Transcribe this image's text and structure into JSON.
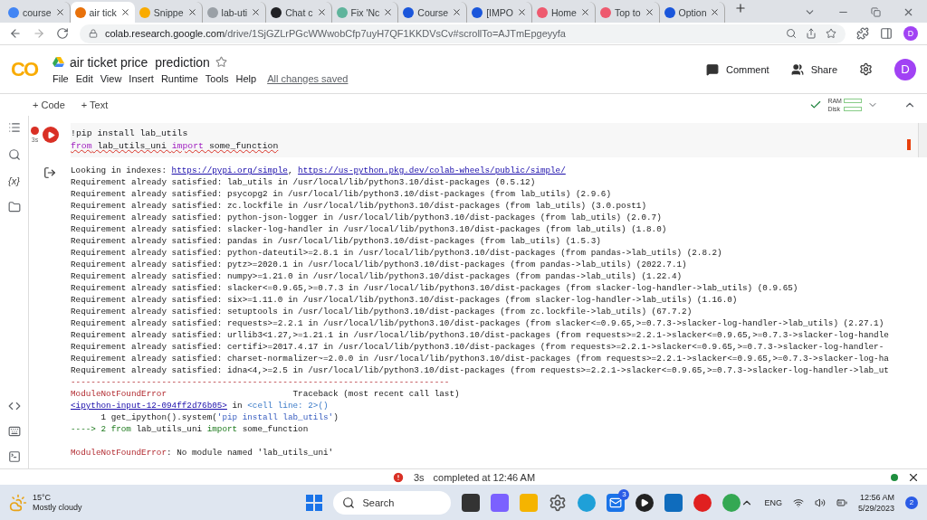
{
  "browser": {
    "tabs": [
      {
        "label": "course",
        "color": "#4285f4",
        "selected": false
      },
      {
        "label": "air tick",
        "color": "#e8710a",
        "selected": true
      },
      {
        "label": "Snippe",
        "color": "#f9ab00",
        "selected": false
      },
      {
        "label": "lab-uti",
        "color": "#9aa0a6",
        "selected": false
      },
      {
        "label": "Chat c",
        "color": "#202124",
        "selected": false
      },
      {
        "label": "Fix 'Nc",
        "color": "#5fb49c",
        "selected": false
      },
      {
        "label": "Course",
        "color": "#1a56db",
        "selected": false
      },
      {
        "label": "[IMPO",
        "color": "#1a56db",
        "selected": false
      },
      {
        "label": "Home",
        "color": "#ee5a6f",
        "selected": false
      },
      {
        "label": "Top to",
        "color": "#ee5a6f",
        "selected": false
      },
      {
        "label": "Option",
        "color": "#1a56db",
        "selected": false
      }
    ],
    "address": {
      "host": "colab.research.google.com",
      "path": "/drive/1SjGZLrPGcWWwobCfp7uyH7QF1KKDVsCv#scrollTo=AJTmEpgeyyfa"
    },
    "profile": "D"
  },
  "header": {
    "logo": "CO",
    "title": "air ticket price  prediction",
    "menu": [
      "File",
      "Edit",
      "View",
      "Insert",
      "Runtime",
      "Tools",
      "Help"
    ],
    "save_status": "All changes saved",
    "comment": "Comment",
    "share": "Share",
    "avatar": "D"
  },
  "toolbar": {
    "add_code": "+ Code",
    "add_text": "+ Text",
    "ram": "RAM",
    "disk": "Disk"
  },
  "sidebar": {
    "variables": "{x}"
  },
  "cell": {
    "run_time": "3s",
    "error": true,
    "code": [
      {
        "segments": [
          {
            "kind": "text",
            "text": "!pip install lab_utils"
          }
        ]
      },
      {
        "segments": [
          {
            "kind": "kw",
            "text": "from"
          },
          {
            "kind": "text",
            "text": " lab_utils_uni "
          },
          {
            "kind": "kw",
            "text": "import"
          },
          {
            "kind": "text",
            "text": " some_function"
          }
        ]
      }
    ],
    "output": [
      {
        "kind": "line",
        "segments": [
          {
            "kind": "text",
            "text": "Looking in indexes: "
          },
          {
            "kind": "link",
            "text": "https://pypi.org/simple"
          },
          {
            "kind": "text",
            "text": ", "
          },
          {
            "kind": "link",
            "text": "https://us-python.pkg.dev/colab-wheels/public/simple/"
          }
        ]
      },
      {
        "kind": "line",
        "segments": [
          {
            "kind": "text",
            "text": "Requirement already satisfied: lab_utils in /usr/local/lib/python3.10/dist-packages (0.5.12)"
          }
        ]
      },
      {
        "kind": "line",
        "segments": [
          {
            "kind": "text",
            "text": "Requirement already satisfied: psycopg2 in /usr/local/lib/python3.10/dist-packages (from lab_utils) (2.9.6)"
          }
        ]
      },
      {
        "kind": "line",
        "segments": [
          {
            "kind": "text",
            "text": "Requirement already satisfied: zc.lockfile in /usr/local/lib/python3.10/dist-packages (from lab_utils) (3.0.post1)"
          }
        ]
      },
      {
        "kind": "line",
        "segments": [
          {
            "kind": "text",
            "text": "Requirement already satisfied: python-json-logger in /usr/local/lib/python3.10/dist-packages (from lab_utils) (2.0.7)"
          }
        ]
      },
      {
        "kind": "line",
        "segments": [
          {
            "kind": "text",
            "text": "Requirement already satisfied: slacker-log-handler in /usr/local/lib/python3.10/dist-packages (from lab_utils) (1.8.0)"
          }
        ]
      },
      {
        "kind": "line",
        "segments": [
          {
            "kind": "text",
            "text": "Requirement already satisfied: pandas in /usr/local/lib/python3.10/dist-packages (from lab_utils) (1.5.3)"
          }
        ]
      },
      {
        "kind": "line",
        "segments": [
          {
            "kind": "text",
            "text": "Requirement already satisfied: python-dateutil>=2.8.1 in /usr/local/lib/python3.10/dist-packages (from pandas->lab_utils) (2.8.2)"
          }
        ]
      },
      {
        "kind": "line",
        "segments": [
          {
            "kind": "text",
            "text": "Requirement already satisfied: pytz>=2020.1 in /usr/local/lib/python3.10/dist-packages (from pandas->lab_utils) (2022.7.1)"
          }
        ]
      },
      {
        "kind": "line",
        "segments": [
          {
            "kind": "text",
            "text": "Requirement already satisfied: numpy>=1.21.0 in /usr/local/lib/python3.10/dist-packages (from pandas->lab_utils) (1.22.4)"
          }
        ]
      },
      {
        "kind": "line",
        "segments": [
          {
            "kind": "text",
            "text": "Requirement already satisfied: slacker<=0.9.65,>=0.7.3 in /usr/local/lib/python3.10/dist-packages (from slacker-log-handler->lab_utils) (0.9.65)"
          }
        ]
      },
      {
        "kind": "line",
        "segments": [
          {
            "kind": "text",
            "text": "Requirement already satisfied: six>=1.11.0 in /usr/local/lib/python3.10/dist-packages (from slacker-log-handler->lab_utils) (1.16.0)"
          }
        ]
      },
      {
        "kind": "line",
        "segments": [
          {
            "kind": "text",
            "text": "Requirement already satisfied: setuptools in /usr/local/lib/python3.10/dist-packages (from zc.lockfile->lab_utils) (67.7.2)"
          }
        ]
      },
      {
        "kind": "line",
        "segments": [
          {
            "kind": "text",
            "text": "Requirement already satisfied: requests>=2.2.1 in /usr/local/lib/python3.10/dist-packages (from slacker<=0.9.65,>=0.7.3->slacker-log-handler->lab_utils) (2.27.1)"
          }
        ]
      },
      {
        "kind": "line",
        "segments": [
          {
            "kind": "text",
            "text": "Requirement already satisfied: urllib3<1.27,>=1.21.1 in /usr/local/lib/python3.10/dist-packages (from requests>=2.2.1->slacker<=0.9.65,>=0.7.3->slacker-log-handle"
          }
        ]
      },
      {
        "kind": "line",
        "segments": [
          {
            "kind": "text",
            "text": "Requirement already satisfied: certifi>=2017.4.17 in /usr/local/lib/python3.10/dist-packages (from requests>=2.2.1->slacker<=0.9.65,>=0.7.3->slacker-log-handler-"
          }
        ]
      },
      {
        "kind": "line",
        "segments": [
          {
            "kind": "text",
            "text": "Requirement already satisfied: charset-normalizer~=2.0.0 in /usr/local/lib/python3.10/dist-packages (from requests>=2.2.1->slacker<=0.9.65,>=0.7.3->slacker-log-ha"
          }
        ]
      },
      {
        "kind": "line",
        "segments": [
          {
            "kind": "text",
            "text": "Requirement already satisfied: idna<4,>=2.5 in /usr/local/lib/python3.10/dist-packages (from requests>=2.2.1->slacker<=0.9.65,>=0.7.3->slacker-log-handler->lab_ut"
          }
        ]
      },
      {
        "kind": "line",
        "segments": [
          {
            "kind": "error",
            "text": "---------------------------------------------------------------------------"
          }
        ]
      },
      {
        "kind": "line",
        "segments": [
          {
            "kind": "error",
            "text": "ModuleNotFoundError"
          },
          {
            "kind": "text",
            "text": "                         Traceback (most recent call last)"
          }
        ]
      },
      {
        "kind": "line",
        "segments": [
          {
            "kind": "link",
            "text": "<ipython-input-12-094ff2d76b05>"
          },
          {
            "kind": "text",
            "text": " in "
          },
          {
            "kind": "loc",
            "text": "<cell line: 2>()"
          }
        ]
      },
      {
        "kind": "line",
        "segments": [
          {
            "kind": "text",
            "text": "      1 get_ipython().system("
          },
          {
            "kind": "str",
            "text": "'pip install lab_utils'"
          },
          {
            "kind": "text",
            "text": ")"
          }
        ]
      },
      {
        "kind": "line",
        "segments": [
          {
            "kind": "arrow",
            "text": "----> 2 from"
          },
          {
            "kind": "text",
            "text": " lab_utils_uni "
          },
          {
            "kind": "arrow",
            "text": "import"
          },
          {
            "kind": "text",
            "text": " some_function"
          }
        ]
      },
      {
        "kind": "blank"
      },
      {
        "kind": "line",
        "segments": [
          {
            "kind": "error",
            "text": "ModuleNotFoundError"
          },
          {
            "kind": "text",
            "text": ": No module named 'lab_utils_uni'"
          }
        ]
      }
    ]
  },
  "status_bar": {
    "error": true,
    "duration": "3s",
    "message": "completed at 12:46 AM",
    "connected": true
  },
  "taskbar": {
    "temperature": "15°C",
    "weather": "Mostly cloudy",
    "search": "Search",
    "mail_badge": "3",
    "language": "ENG",
    "time": "12:56 AM",
    "date": "5/29/2023",
    "notifications": "2"
  }
}
